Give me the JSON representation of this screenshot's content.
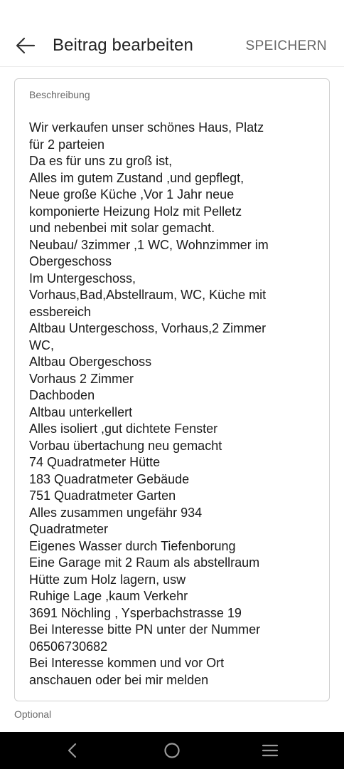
{
  "header": {
    "title": "Beitrag bearbeiten",
    "save_label": "SPEICHERN",
    "back_icon": "arrow-left-icon"
  },
  "description_field": {
    "label": "Beschreibung",
    "lines": [
      "Wir verkaufen unser schönes Haus, Platz",
      "für 2 parteien",
      "Da es für uns zu groß ist,",
      "Alles im gutem Zustand ,und gepflegt,",
      "Neue große Küche ,Vor 1 Jahr neue",
      "komponierte Heizung Holz mit Pelletz",
      "und nebenbei mit solar gemacht.",
      "Neubau/ 3zimmer ,1 WC, Wohnzimmer im",
      "Obergeschoss",
      "Im Untergeschoss,",
      "Vorhaus,Bad,Abstellraum, WC, Küche mit",
      "essbereich",
      "Altbau Untergeschoss, Vorhaus,2 Zimmer",
      "WC,",
      "Altbau Obergeschoss",
      "Vorhaus 2 Zimmer",
      "Dachboden",
      "Altbau unterkellert",
      "Alles isoliert ,gut dichtete Fenster",
      "Vorbau übertachung neu gemacht",
      "74 Quadratmeter Hütte",
      "183 Quadratmeter Gebäude",
      "751 Quadratmeter Garten",
      "Alles zusammen ungefähr 934",
      "Quadratmeter",
      "Eigenes Wasser durch Tiefenborung",
      "Eine Garage mit 2 Raum als abstellraum",
      "Hütte zum Holz lagern, usw",
      "Ruhige Lage ,kaum Verkehr",
      "3691 Nöchling , Ysperbachstrasse 19",
      "Bei Interesse bitte PN unter der Nummer",
      "06506730682",
      "Bei Interesse kommen und vor Ort",
      "anschauen oder bei mir melden"
    ],
    "helper_text": "Optional"
  },
  "system_nav": {
    "back_icon": "nav-back-icon",
    "home_icon": "nav-home-icon",
    "recents_icon": "nav-recents-icon",
    "background_color": "#000000"
  }
}
